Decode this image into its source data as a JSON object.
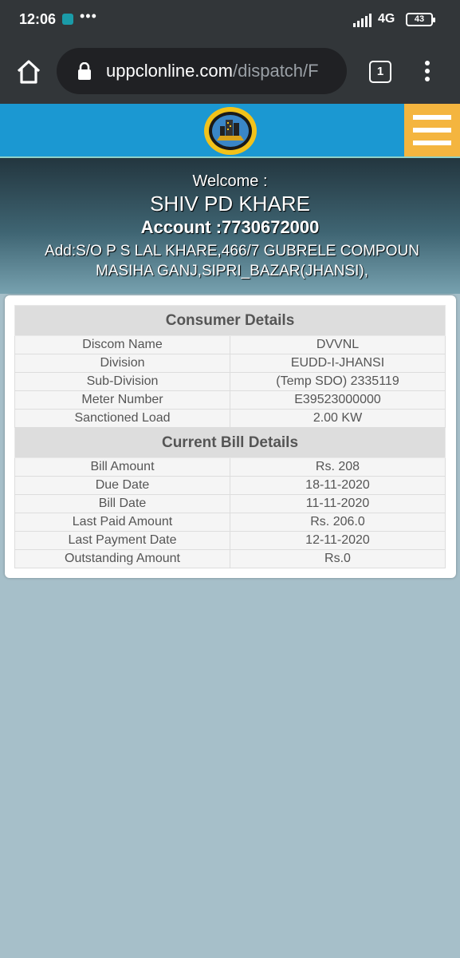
{
  "status": {
    "time": "12:06",
    "network": "4G",
    "battery": "43"
  },
  "browser": {
    "url_domain": "uppclonline.com",
    "url_path": "/dispatch/F",
    "tab_count": "1"
  },
  "welcome": {
    "label": "Welcome :",
    "name": "SHIV PD KHARE",
    "account": "Account :7730672000",
    "address": "Add:S/O P S LAL KHARE,466/7 GUBRELE COMPOUN MASIHA GANJ,SIPRI_BAZAR(JHANSI),"
  },
  "consumer": {
    "heading": "Consumer Details",
    "rows": [
      {
        "label": "Discom Name",
        "value": "DVVNL"
      },
      {
        "label": "Division",
        "value": "EUDD-I-JHANSI"
      },
      {
        "label": "Sub-Division",
        "value": "(Temp SDO) 2335119"
      },
      {
        "label": "Meter Number",
        "value": "E39523000000"
      },
      {
        "label": "Sanctioned Load",
        "value": "2.00 KW"
      }
    ]
  },
  "bill": {
    "heading": "Current Bill Details",
    "rows": [
      {
        "label": "Bill Amount",
        "value": "Rs. 208"
      },
      {
        "label": "Due Date",
        "value": "18-11-2020"
      },
      {
        "label": "Bill Date",
        "value": "11-11-2020"
      },
      {
        "label": "Last Paid Amount",
        "value": "Rs. 206.0"
      },
      {
        "label": "Last Payment Date",
        "value": "12-11-2020"
      },
      {
        "label": "Outstanding Amount",
        "value": "Rs.0"
      }
    ]
  },
  "colors": {
    "header_blue": "#1b98d2",
    "menu_orange": "#f4b53f",
    "page_background": "#a6bfc9"
  },
  "icons": [
    "app-notification-icon",
    "signal-icon",
    "battery-icon",
    "home-icon",
    "lock-icon",
    "tabs-icon",
    "overflow-menu-icon",
    "site-logo",
    "hamburger-menu-icon"
  ]
}
